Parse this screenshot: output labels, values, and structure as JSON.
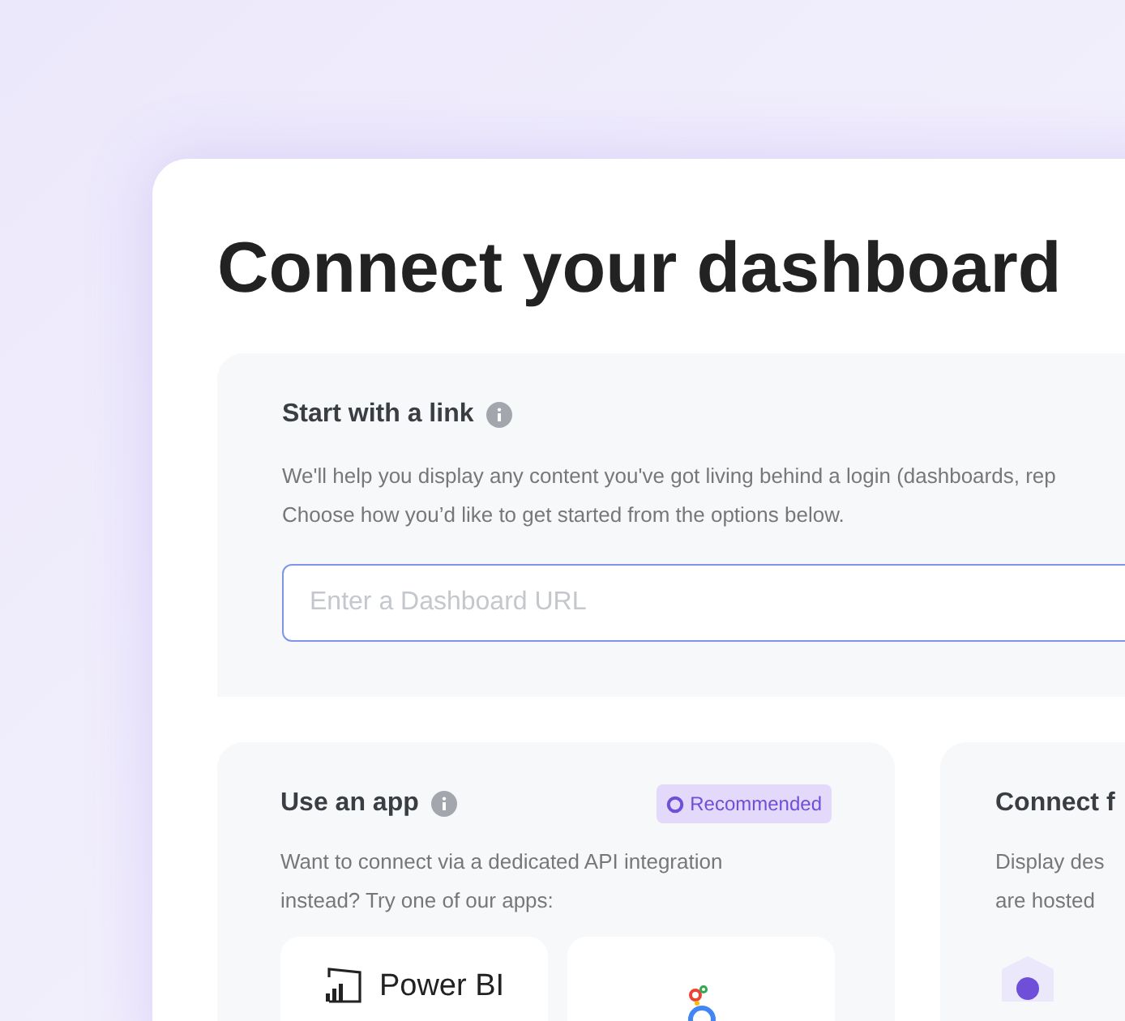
{
  "title": "Connect your dashboard",
  "link_section": {
    "heading": "Start with a link",
    "description": [
      "We'll help you display any content you've got living behind a login (dashboards, rep",
      "Choose how you’d like to get started from the options below."
    ],
    "url_field": {
      "placeholder": "Enter a Dashboard URL"
    }
  },
  "app_section": {
    "heading": "Use an app",
    "badge": "Recommended",
    "description": [
      "Want to connect via a dedicated API integration",
      "instead? Try one of our apps:"
    ],
    "apps": [
      {
        "kind": "powerbi",
        "label": "Power BI"
      },
      {
        "kind": "looker"
      }
    ]
  },
  "other_section": {
    "heading": "Connect f",
    "description": [
      "Display des",
      "are hosted"
    ]
  }
}
